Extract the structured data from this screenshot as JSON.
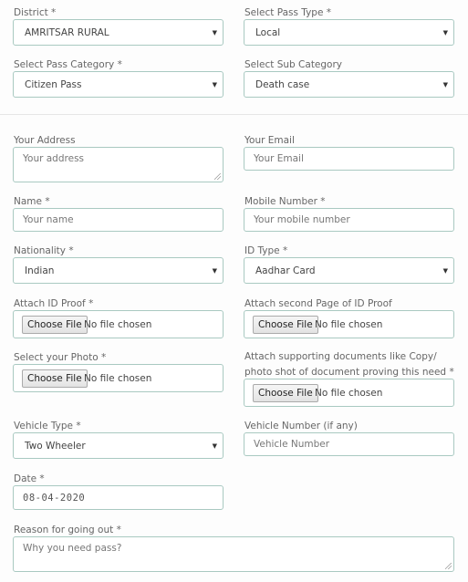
{
  "form": {
    "district": {
      "label": "District *",
      "value": "AMRITSAR RURAL"
    },
    "pass_type": {
      "label": "Select Pass Type *",
      "value": "Local"
    },
    "pass_category": {
      "label": "Select Pass Category *",
      "value": "Citizen Pass"
    },
    "sub_category": {
      "label": "Select Sub Category",
      "value": "Death case"
    },
    "address": {
      "label": "Your Address",
      "placeholder": "Your address"
    },
    "email": {
      "label": "Your Email",
      "placeholder": "Your Email"
    },
    "name": {
      "label": "Name *",
      "placeholder": "Your name"
    },
    "mobile": {
      "label": "Mobile Number *",
      "placeholder": "Your mobile number"
    },
    "nationality": {
      "label": "Nationality *",
      "value": "Indian"
    },
    "id_type": {
      "label": "ID Type *",
      "value": "Aadhar Card"
    },
    "id_proof": {
      "label": "Attach ID Proof *",
      "button": "Choose File",
      "status": "No file chosen"
    },
    "id_proof_second": {
      "label": "Attach second Page of ID Proof",
      "button": "Choose File",
      "status": "No file chosen"
    },
    "photo": {
      "label": "Select your Photo *",
      "button": "Choose File",
      "status": "No file chosen"
    },
    "supporting_docs": {
      "label": "Attach supporting documents like Copy/ photo shot of document proving this need *",
      "button": "Choose File",
      "status": "No file chosen"
    },
    "vehicle_type": {
      "label": "Vehicle Type *",
      "value": "Two Wheeler"
    },
    "vehicle_number": {
      "label": "Vehicle Number (if any)",
      "placeholder": "Vehicle Number"
    },
    "date": {
      "label": "Date *",
      "value": "08-04-2020"
    },
    "reason": {
      "label": "Reason for going out *",
      "placeholder": "Why you need pass?"
    }
  },
  "icons": {
    "caret": "▼"
  }
}
